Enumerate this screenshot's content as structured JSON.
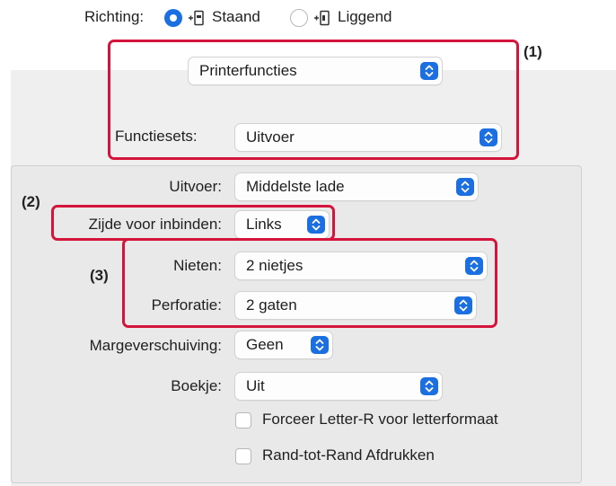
{
  "orientation": {
    "label": "Richting:",
    "portrait_label": "Staand",
    "landscape_label": "Liggend",
    "selected": "portrait"
  },
  "panel_menu": {
    "value": "Printerfuncties"
  },
  "feature_sets": {
    "label": "Functiesets:",
    "value": "Uitvoer"
  },
  "fields": {
    "output": {
      "label": "Uitvoer:",
      "value": "Middelste lade"
    },
    "binding": {
      "label": "Zijde voor inbinden:",
      "value": "Links"
    },
    "staple": {
      "label": "Nieten:",
      "value": "2 nietjes"
    },
    "punch": {
      "label": "Perforatie:",
      "value": "2 gaten"
    },
    "margin_shift": {
      "label": "Margeverschuiving:",
      "value": "Geen"
    },
    "booklet": {
      "label": "Boekje:",
      "value": "Uit"
    }
  },
  "checkboxes": {
    "force_letter_r": {
      "label": "Forceer Letter-R voor letterformaat",
      "checked": false
    },
    "edge_to_edge": {
      "label": "Rand-tot-Rand Afdrukken",
      "checked": false
    }
  },
  "callouts": {
    "c1": "(1)",
    "c2": "(2)",
    "c3": "(3)"
  },
  "colors": {
    "accent": "#1b6fe0",
    "highlight": "#d5143c"
  }
}
